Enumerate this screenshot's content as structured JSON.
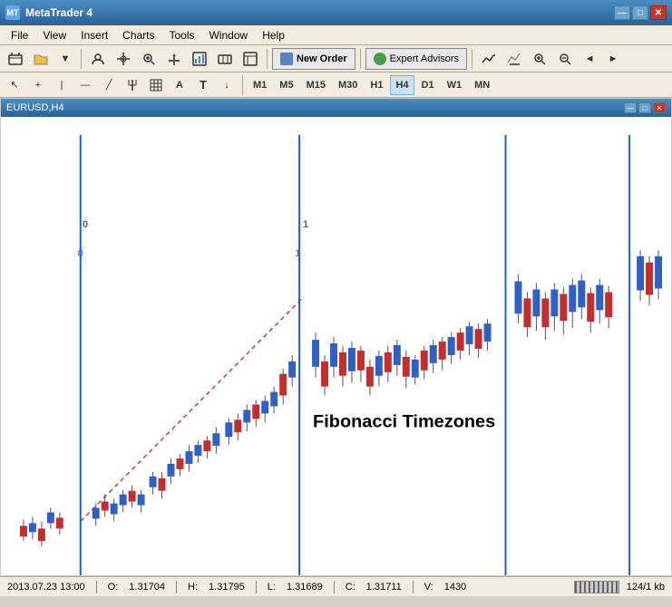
{
  "window": {
    "title": "MetaTrader 4",
    "icon": "MT4"
  },
  "titlebar": {
    "title": "MetaTrader 4",
    "minimize": "—",
    "maximize": "□",
    "close": "✕"
  },
  "menubar": {
    "items": [
      "File",
      "View",
      "Insert",
      "Charts",
      "Tools",
      "Window",
      "Help"
    ]
  },
  "toolbar1": {
    "new_order_label": "New Order",
    "expert_advisors_label": "Expert Advisors"
  },
  "toolbar2": {
    "timeframes": [
      "M1",
      "M5",
      "M15",
      "M30",
      "H1",
      "H4",
      "D1",
      "W1",
      "MN"
    ],
    "active": "H4"
  },
  "chart": {
    "title": "EURUSD,H4",
    "fib_label": "Fibonacci Timezones",
    "fib_numbers": [
      "0",
      "1"
    ],
    "vertical_lines": [
      88,
      330,
      561,
      692
    ]
  },
  "statusbar": {
    "datetime": "2013.07.23 13:00",
    "open_label": "O:",
    "open_value": "1.31704",
    "high_label": "H:",
    "high_value": "1.31795",
    "low_label": "L:",
    "low_value": "1.31689",
    "close_label": "C:",
    "close_value": "1.31711",
    "volume_label": "V:",
    "volume_value": "1430",
    "size_info": "124/1 kb"
  }
}
